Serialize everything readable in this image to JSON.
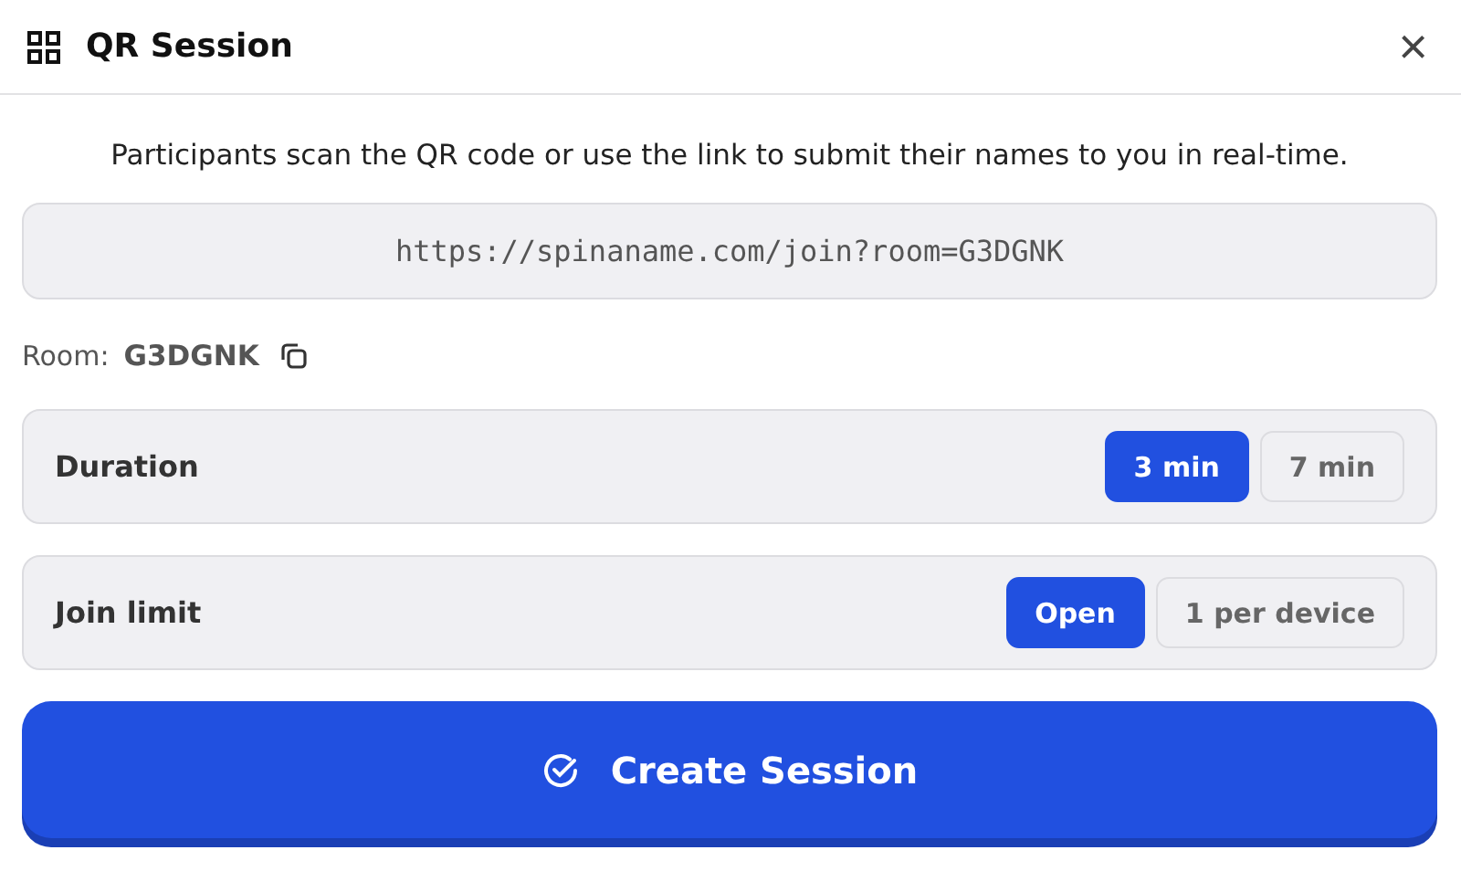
{
  "dialog": {
    "title": "QR Session",
    "close": "×"
  },
  "description": "Participants scan the QR code or use the link to submit their names to you in real-time.",
  "link": "https://spinaname.com/join?room=G3DGNK",
  "room": {
    "label": "Room:",
    "code": "G3DGNK"
  },
  "settings": [
    {
      "label": "Duration",
      "options": [
        {
          "label": "3 min",
          "selected": true
        },
        {
          "label": "7 min",
          "selected": false
        }
      ]
    },
    {
      "label": "Join limit",
      "options": [
        {
          "label": "Open",
          "selected": true
        },
        {
          "label": "1 per device",
          "selected": false
        }
      ]
    }
  ],
  "primary_button": "Create Session"
}
